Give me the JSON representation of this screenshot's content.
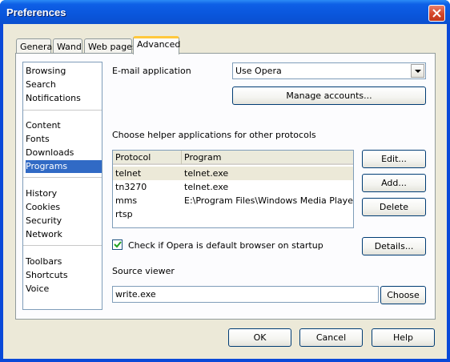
{
  "window": {
    "title": "Preferences"
  },
  "tabs": [
    {
      "label": "General"
    },
    {
      "label": "Wand"
    },
    {
      "label": "Web pages"
    },
    {
      "label": "Advanced"
    }
  ],
  "sidebar": {
    "groups": [
      [
        "Browsing",
        "Search",
        "Notifications"
      ],
      [
        "Content",
        "Fonts",
        "Downloads",
        "Programs"
      ],
      [
        "History",
        "Cookies",
        "Security",
        "Network"
      ],
      [
        "Toolbars",
        "Shortcuts",
        "Voice"
      ]
    ],
    "selected": "Programs"
  },
  "email": {
    "label": "E-mail application",
    "selected_value": "Use Opera",
    "manage_button": "Manage accounts..."
  },
  "helpers": {
    "heading": "Choose helper applications for other protocols",
    "columns": [
      "Protocol",
      "Program"
    ],
    "rows": [
      {
        "protocol": "telnet",
        "program": "telnet.exe"
      },
      {
        "protocol": "tn3270",
        "program": "telnet.exe"
      },
      {
        "protocol": "mms",
        "program": "E:\\Program Files\\Windows Media Player\\..."
      },
      {
        "protocol": "rtsp",
        "program": ""
      }
    ],
    "buttons": {
      "edit": "Edit...",
      "add": "Add...",
      "delete": "Delete"
    }
  },
  "default_check": {
    "label": "Check if Opera is default browser on startup",
    "checked": true,
    "details_button": "Details..."
  },
  "source_viewer": {
    "label": "Source viewer",
    "value": "write.exe",
    "choose_button": "Choose"
  },
  "dialog_buttons": {
    "ok": "OK",
    "cancel": "Cancel",
    "help": "Help"
  }
}
